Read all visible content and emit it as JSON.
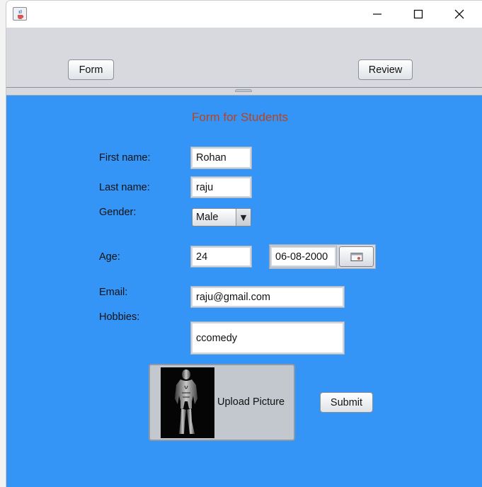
{
  "window": {
    "icon": "java-cup-icon",
    "controls": {
      "minimize": "minimize-icon",
      "maximize": "maximize-icon",
      "close": "close-icon"
    }
  },
  "tabs": {
    "form_label": "Form",
    "review_label": "Review"
  },
  "form": {
    "title": "Form for Students",
    "first_name": {
      "label": "First name:",
      "value": "Rohan"
    },
    "last_name": {
      "label": "Last name:",
      "value": "raju"
    },
    "gender": {
      "label": "Gender:",
      "value": "Male"
    },
    "age": {
      "label": "Age:",
      "value": "24"
    },
    "date": {
      "value": "06-08-2000",
      "icon": "calendar-icon"
    },
    "email": {
      "label": "Email:",
      "value": "raju@gmail.com"
    },
    "hobbies": {
      "label": "Hobbies:",
      "value": "ccomedy"
    },
    "upload": {
      "label": "Upload Picture",
      "thumbnail": "figure-photo-thumbnail"
    },
    "submit_label": "Submit"
  },
  "colors": {
    "panel_background": "#3595f7",
    "title_color": "#b8431d",
    "tab_bar_background": "#d7d9de"
  }
}
